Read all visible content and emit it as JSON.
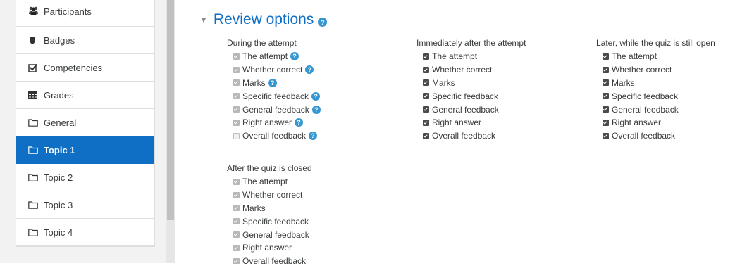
{
  "nav": {
    "items": [
      {
        "label": "Participants",
        "icon": "users-icon"
      },
      {
        "label": "Badges",
        "icon": "shield-icon"
      },
      {
        "label": "Competencies",
        "icon": "checkbox-icon"
      },
      {
        "label": "Grades",
        "icon": "table-icon"
      },
      {
        "label": "General",
        "icon": "folder-icon"
      },
      {
        "label": "Topic 1",
        "icon": "folder-icon",
        "active": true
      },
      {
        "label": "Topic 2",
        "icon": "folder-icon"
      },
      {
        "label": "Topic 3",
        "icon": "folder-icon"
      },
      {
        "label": "Topic 4",
        "icon": "folder-icon"
      }
    ]
  },
  "section": {
    "title": "Review options",
    "help": "?"
  },
  "columns": [
    {
      "title": "During the attempt",
      "options": [
        {
          "label": "The attempt",
          "checked": true,
          "disabled": true,
          "help": true
        },
        {
          "label": "Whether correct",
          "checked": true,
          "disabled": true,
          "help": true
        },
        {
          "label": "Marks",
          "checked": true,
          "disabled": true,
          "help": true
        },
        {
          "label": "Specific feedback",
          "checked": true,
          "disabled": true,
          "help": true
        },
        {
          "label": "General feedback",
          "checked": true,
          "disabled": true,
          "help": true
        },
        {
          "label": "Right answer",
          "checked": true,
          "disabled": true,
          "help": true
        },
        {
          "label": "Overall feedback",
          "checked": false,
          "disabled": true,
          "help": true
        }
      ]
    },
    {
      "title": "Immediately after the attempt",
      "options": [
        {
          "label": "The attempt",
          "checked": true,
          "disabled": false
        },
        {
          "label": "Whether correct",
          "checked": true,
          "disabled": false
        },
        {
          "label": "Marks",
          "checked": true,
          "disabled": false
        },
        {
          "label": "Specific feedback",
          "checked": true,
          "disabled": false
        },
        {
          "label": "General feedback",
          "checked": true,
          "disabled": false
        },
        {
          "label": "Right answer",
          "checked": true,
          "disabled": false
        },
        {
          "label": "Overall feedback",
          "checked": true,
          "disabled": false
        }
      ]
    },
    {
      "title": "Later, while the quiz is still open",
      "options": [
        {
          "label": "The attempt",
          "checked": true,
          "disabled": false
        },
        {
          "label": "Whether correct",
          "checked": true,
          "disabled": false
        },
        {
          "label": "Marks",
          "checked": true,
          "disabled": false
        },
        {
          "label": "Specific feedback",
          "checked": true,
          "disabled": false
        },
        {
          "label": "General feedback",
          "checked": true,
          "disabled": false
        },
        {
          "label": "Right answer",
          "checked": true,
          "disabled": false
        },
        {
          "label": "Overall feedback",
          "checked": true,
          "disabled": false
        }
      ]
    },
    {
      "title": "After the quiz is closed",
      "options": [
        {
          "label": "The attempt",
          "checked": true,
          "disabled": true
        },
        {
          "label": "Whether correct",
          "checked": true,
          "disabled": true
        },
        {
          "label": "Marks",
          "checked": true,
          "disabled": true
        },
        {
          "label": "Specific feedback",
          "checked": true,
          "disabled": true
        },
        {
          "label": "General feedback",
          "checked": true,
          "disabled": true
        },
        {
          "label": "Right answer",
          "checked": true,
          "disabled": true
        },
        {
          "label": "Overall feedback",
          "checked": true,
          "disabled": true
        }
      ]
    }
  ],
  "colors": {
    "accent": "#0f6fc5",
    "help": "#3596d2"
  }
}
